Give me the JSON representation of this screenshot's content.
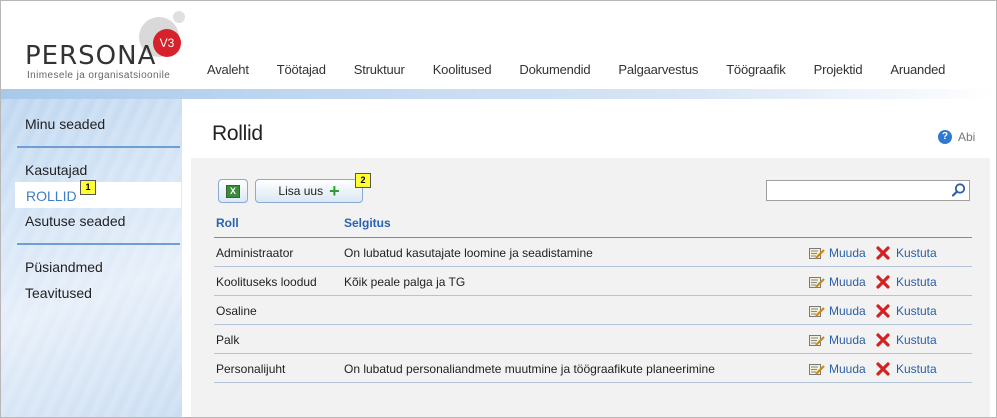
{
  "app": {
    "logo_name": "PERSONA",
    "logo_version": "V3",
    "logo_tagline": "Inimesele ja organisatsioonile"
  },
  "nav": {
    "items": [
      "Avaleht",
      "Töötajad",
      "Struktuur",
      "Koolitused",
      "Dokumendid",
      "Palgaarvestus",
      "Töögraafik",
      "Projektid",
      "Aruanded"
    ]
  },
  "sidebar": {
    "my_settings": "Minu seaded",
    "users": "Kasutajad",
    "roles": "ROLLID",
    "roles_badge": "1",
    "org_settings": "Asutuse seaded",
    "master_data": "Püsiandmed",
    "notifications": "Teavitused"
  },
  "page": {
    "title": "Rollid",
    "help_label": "Abi"
  },
  "toolbar": {
    "add_label": "Lisa uus",
    "add_badge": "2",
    "search_value": "",
    "search_placeholder": ""
  },
  "table": {
    "columns": [
      "Roll",
      "Selgitus"
    ],
    "edit_label": "Muuda",
    "delete_label": "Kustuta",
    "rows": [
      {
        "role": "Administraator",
        "desc": "On lubatud kasutajate loomine ja seadistamine"
      },
      {
        "role": "Koolituseks loodud",
        "desc": "Kõik peale palga ja TG"
      },
      {
        "role": "Osaline",
        "desc": ""
      },
      {
        "role": "Palk",
        "desc": ""
      },
      {
        "role": "Personalijuht",
        "desc": "On lubatud personaliandmete muutmine ja töögraafikute planeerimine"
      }
    ]
  },
  "colors": {
    "accent": "#2b62b0",
    "active_sidebar_text": "#3d7fc4",
    "badge": "#ffff33",
    "logo_red": "#d7212b"
  }
}
